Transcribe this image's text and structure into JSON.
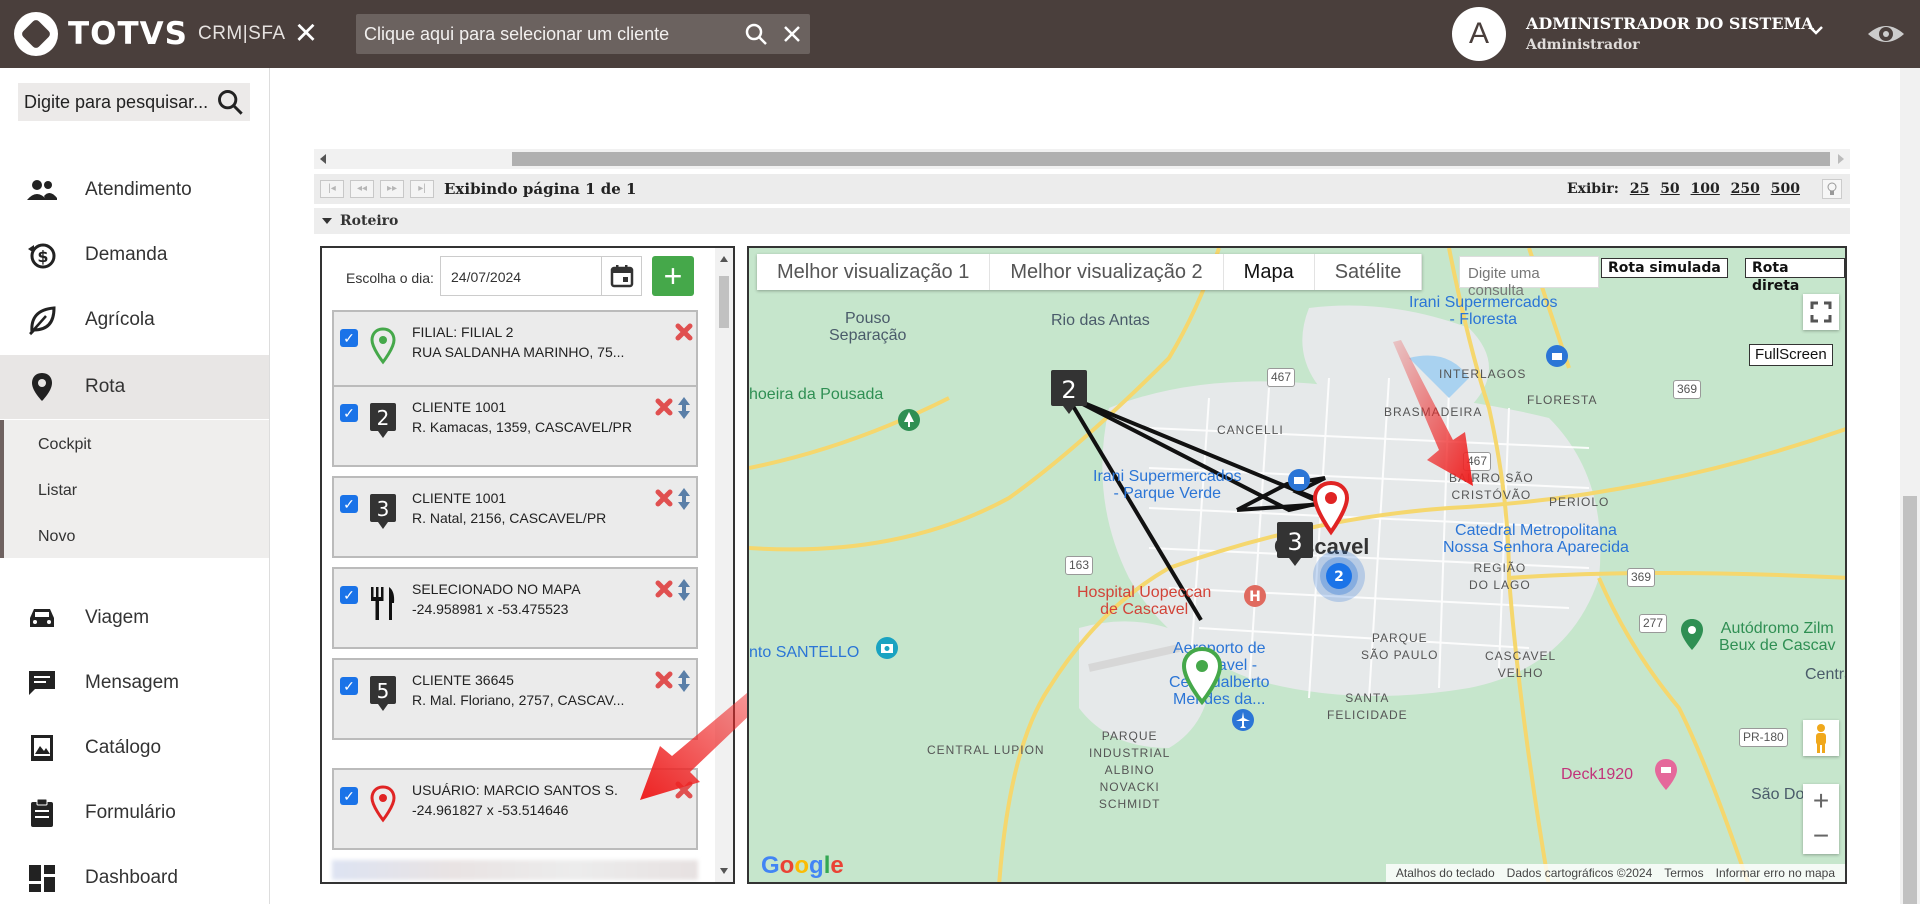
{
  "header": {
    "brand": "TOTVS",
    "product": "CRM|SFA",
    "client_search_placeholder": "Clique aqui para selecionar um cliente",
    "avatar_initial": "A",
    "user_name": "ADMINISTRADOR DO SISTEMA",
    "user_role": "Administrador",
    "colors": {
      "bar": "#4a3f3c"
    }
  },
  "sidebar": {
    "search_placeholder": "Digite para pesquisar...",
    "items": [
      {
        "label": "Atendimento",
        "icon": "people-icon"
      },
      {
        "label": "Demanda",
        "icon": "money-cycle-icon"
      },
      {
        "label": "Agrícola",
        "icon": "leaf-icon"
      },
      {
        "label": "Rota",
        "icon": "location-pin-icon"
      },
      {
        "label": "Viagem",
        "icon": "car-icon"
      },
      {
        "label": "Mensagem",
        "icon": "message-icon"
      },
      {
        "label": "Catálogo",
        "icon": "catalog-icon"
      },
      {
        "label": "Formulário",
        "icon": "clipboard-icon"
      },
      {
        "label": "Dashboard",
        "icon": "dashboard-icon"
      }
    ],
    "rota_submenu": [
      "Cockpit",
      "Listar",
      "Novo"
    ]
  },
  "grid": {
    "page_info": "Exibindo página 1 de 1",
    "exibir_label": "Exibir:",
    "page_sizes": [
      "25",
      "50",
      "100",
      "250",
      "500"
    ]
  },
  "roteiro": {
    "title": "Roteiro",
    "day_label": "Escolha o dia:",
    "date_value": "24/07/2024",
    "stops": [
      {
        "marker": "green-pin",
        "line1": "FILIAL: FILIAL 2",
        "line2": "RUA SALDANHA MARINHO, 75..."
      },
      {
        "marker": "2",
        "line1": "CLIENTE 1001",
        "line2": "R. Kamacas, 1359, CASCAVEL/PR"
      },
      {
        "marker": "3",
        "line1": "CLIENTE 1001",
        "line2": "R. Natal, 2156, CASCAVEL/PR"
      },
      {
        "marker": "restaurant",
        "line1": "SELECIONADO NO MAPA",
        "line2": "-24.958981 x -53.475523"
      },
      {
        "marker": "5",
        "line1": "CLIENTE 36645",
        "line2": "R. Mal. Floriano, 2757, CASCAV..."
      },
      {
        "marker": "red-pin",
        "line1": "USUÁRIO: MARCIO SANTOS S.",
        "line2": "-24.961827 x -53.514646"
      }
    ]
  },
  "map": {
    "tabs": [
      "Melhor visualização 1",
      "Melhor visualização 2",
      "Mapa",
      "Satélite"
    ],
    "selected_tab": "Mapa",
    "query_placeholder": "Digite uma consulta",
    "btn_simulated": "Rota simulada",
    "btn_direct": "Rota direta",
    "fullscreen_label": "FullScreen",
    "markers": {
      "m2": "2",
      "m3": "3",
      "cluster": "2"
    },
    "labels": {
      "pouso": "Pouso\nSeparação",
      "rio": "Rio das Antas",
      "irani_floresta": "Irani Supermercados\n- Floresta",
      "interlagos": "INTERLAGOS",
      "floresta": "FLORESTA",
      "brasmadeira": "BRASMADEIRA",
      "cancelli": "CANCELLI",
      "cachoeira": "hoeira da Pousada",
      "irani_verde": "Irani Supermercados\n- Parque Verde",
      "bairro": "BAIRRO SÃO\nCRISTÓVÃO",
      "perio": "PERIOLO",
      "catedral": "Catedral Metropolitana\nNossa Senhora Aparecida",
      "regiao": "REGIÃO\nDO LAGO",
      "cascavel": "Cascavel",
      "hospital": "Hospital Uopeccan\nde Cascavel",
      "parque_sp": "PARQUE\nSÃO PAULO",
      "cascavel_velho": "CASCAVEL\nVELHO",
      "autodromo": "Autódromo Zilm\nBeux de Cascav",
      "central": "Centra",
      "santello": "nto SANTELLO",
      "aeroporto": "Aeroporto de\nCascavel -\nCel. Adalberto\nMendes da...",
      "santa": "SANTA\nFELICIDADE",
      "central_lupion": "CENTRAL LUPION",
      "parque_ind": "PARQUE\nINDUSTRIAL\nALBINO\nNOVACKI\nSCHMIDT",
      "deck": "Deck1920",
      "sao_do": "São Do",
      "r467a": "467",
      "r467b": "467",
      "r369a": "369",
      "r369b": "369",
      "r277": "277",
      "r163": "163",
      "pr180": "PR-180"
    },
    "google_logo": "Google",
    "footer": [
      "Atalhos do teclado",
      "Dados cartográficos ©2024",
      "Termos",
      "Informar erro no mapa"
    ]
  }
}
